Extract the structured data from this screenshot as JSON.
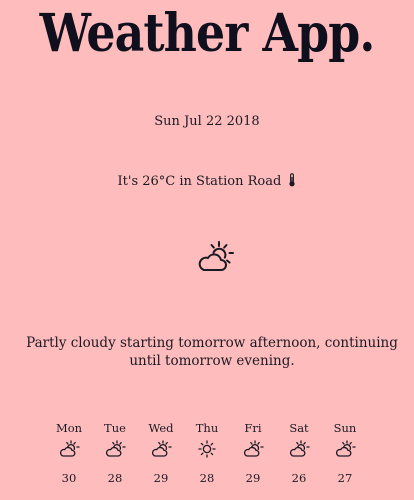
{
  "app": {
    "title": "Weather App."
  },
  "current": {
    "date": "Sun Jul 22 2018",
    "location_text": "It's 26°C in Station Road",
    "location_icon": "thermometer-icon",
    "icon": "partly-cloudy-day-icon",
    "summary": "Partly cloudy starting tomorrow afternoon, continuing until tomorrow evening."
  },
  "forecast": [
    {
      "day": "Mon",
      "icon": "partly-cloudy-day-icon",
      "temp": "30"
    },
    {
      "day": "Tue",
      "icon": "partly-cloudy-day-icon",
      "temp": "28"
    },
    {
      "day": "Wed",
      "icon": "partly-cloudy-day-icon",
      "temp": "29"
    },
    {
      "day": "Thu",
      "icon": "sun-icon",
      "temp": "28"
    },
    {
      "day": "Fri",
      "icon": "partly-cloudy-day-icon",
      "temp": "29"
    },
    {
      "day": "Sat",
      "icon": "partly-cloudy-day-icon",
      "temp": "26"
    },
    {
      "day": "Sun",
      "icon": "partly-cloudy-day-icon",
      "temp": "27"
    }
  ],
  "colors": {
    "background": "#ffbcbc",
    "text": "#1a1a24"
  }
}
